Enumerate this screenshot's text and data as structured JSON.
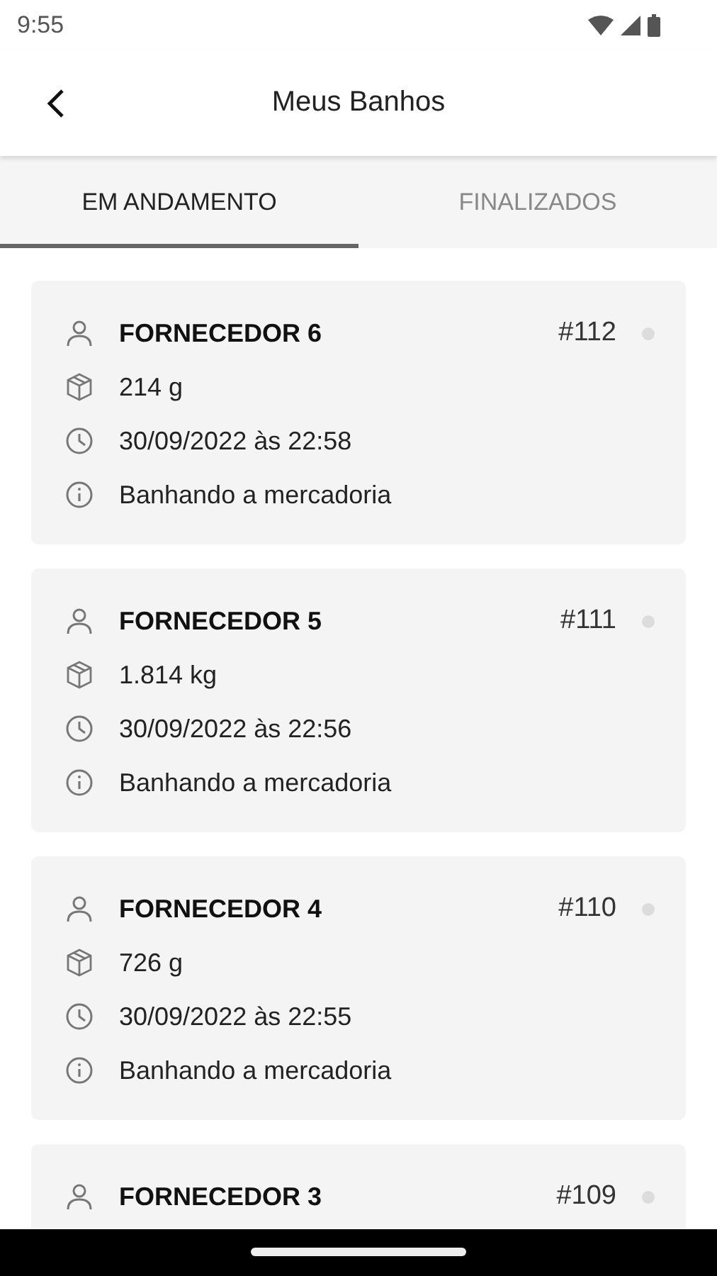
{
  "status_bar": {
    "time": "9:55"
  },
  "app_bar": {
    "title": "Meus Banhos"
  },
  "tabs": [
    {
      "label": "EM ANDAMENTO",
      "selected": true
    },
    {
      "label": "FINALIZADOS",
      "selected": false
    }
  ],
  "cards": [
    {
      "supplier": "FORNECEDOR 6",
      "number": "#112",
      "weight": "214 g",
      "datetime": "30/09/2022 às 22:58",
      "status": "Banhando a mercadoria"
    },
    {
      "supplier": "FORNECEDOR 5",
      "number": "#111",
      "weight": "1.814 kg",
      "datetime": "30/09/2022 às 22:56",
      "status": "Banhando a mercadoria"
    },
    {
      "supplier": "FORNECEDOR 4",
      "number": "#110",
      "weight": "726 g",
      "datetime": "30/09/2022 às 22:55",
      "status": "Banhando a mercadoria"
    },
    {
      "supplier": "FORNECEDOR 3",
      "number": "#109"
    }
  ]
}
